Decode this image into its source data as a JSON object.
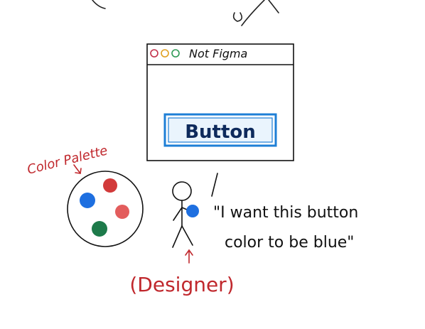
{
  "window": {
    "title": "Not Figma",
    "traffic_lights": [
      "#c2304a",
      "#e0a020",
      "#2e9a55"
    ]
  },
  "button": {
    "label": "Button",
    "border_color": "#1e7fd6",
    "fill_color": "#eaf4fd",
    "text_color": "#0e2a5c"
  },
  "palette": {
    "label": "Color Palette",
    "label_color": "#c0282d",
    "swatches": [
      {
        "name": "blue",
        "color": "#1e6fe0"
      },
      {
        "name": "red",
        "color": "#d23a3a"
      },
      {
        "name": "pink",
        "color": "#e35d5d"
      },
      {
        "name": "green",
        "color": "#1d7a4a"
      }
    ]
  },
  "designer": {
    "label": "(Designer)",
    "label_color": "#c0282d",
    "held_color": "#1e6fe0"
  },
  "quote": {
    "line1": "\"I want this button",
    "line2": "color to be blue\""
  }
}
